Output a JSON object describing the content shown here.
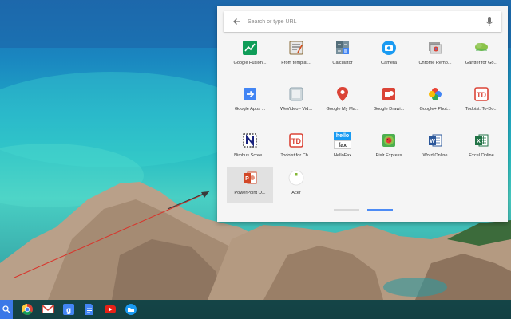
{
  "launcher": {
    "search_placeholder": "Search or type URL",
    "apps": [
      {
        "label": "Google Fusion...",
        "icon": "google-fusion-tables-icon"
      },
      {
        "label": "From templat...",
        "icon": "from-templates-icon"
      },
      {
        "label": "Calculator",
        "icon": "calculator-icon"
      },
      {
        "label": "Camera",
        "icon": "camera-icon"
      },
      {
        "label": "Chrome Remo...",
        "icon": "chrome-remote-desktop-icon"
      },
      {
        "label": "Gantter for Go...",
        "icon": "gantter-icon"
      },
      {
        "label": "Google Apps ...",
        "icon": "google-apps-script-icon"
      },
      {
        "label": "WeVideo - Vid...",
        "icon": "wevideo-icon"
      },
      {
        "label": "Google My Ma...",
        "icon": "google-my-maps-icon"
      },
      {
        "label": "Google Drawi...",
        "icon": "google-drawings-icon"
      },
      {
        "label": "Google+ Phot...",
        "icon": "google-photos-icon"
      },
      {
        "label": "Todoist: To-Do...",
        "icon": "todoist-icon"
      },
      {
        "label": "Nimbus Scree...",
        "icon": "nimbus-screenshot-icon"
      },
      {
        "label": "Todoist for Ch...",
        "icon": "todoist-chrome-icon"
      },
      {
        "label": "HelloFax",
        "icon": "hellofax-icon"
      },
      {
        "label": "Pixlr Express",
        "icon": "pixlr-express-icon"
      },
      {
        "label": "Word Online",
        "icon": "word-online-icon"
      },
      {
        "label": "Excel Online",
        "icon": "excel-online-icon"
      },
      {
        "label": "PowerPoint O...",
        "icon": "powerpoint-online-icon"
      },
      {
        "label": "Acer",
        "icon": "acer-icon"
      }
    ],
    "hellofax_text": [
      "hello",
      "fax"
    ]
  },
  "shelf": {
    "apps": [
      "search-launcher-icon",
      "chrome-icon",
      "gmail-icon",
      "google-search-icon",
      "google-docs-icon",
      "youtube-icon",
      "files-icon"
    ]
  },
  "colors": {
    "accent": "#4c8bf5",
    "annotation_arrow": "#d9342b"
  }
}
